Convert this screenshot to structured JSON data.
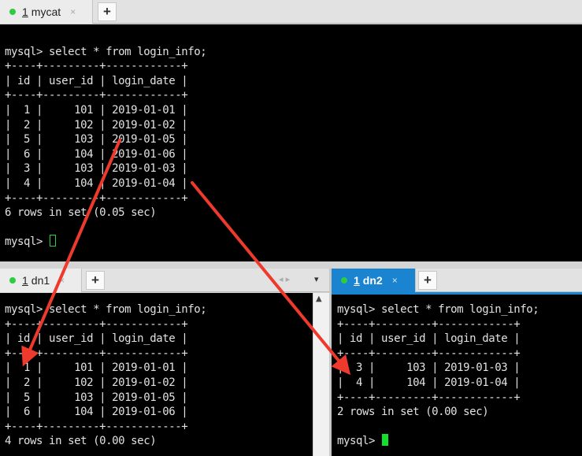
{
  "top_pane": {
    "tab": {
      "number": "1",
      "name": "mycat",
      "close": "×"
    },
    "add_tab": "+",
    "lines": [
      "",
      "mysql> select * from login_info;",
      "+----+---------+------------+",
      "| id | user_id | login_date |",
      "+----+---------+------------+",
      "|  1 |     101 | 2019-01-01 |",
      "|  2 |     102 | 2019-01-02 |",
      "|  5 |     103 | 2019-01-05 |",
      "|  6 |     104 | 2019-01-06 |",
      "|  3 |     103 | 2019-01-03 |",
      "|  4 |     104 | 2019-01-04 |",
      "+----+---------+------------+",
      "6 rows in set (0.05 sec)",
      "",
      "mysql> "
    ]
  },
  "left_pane": {
    "tab": {
      "number": "1",
      "name": "dn1",
      "close": "×"
    },
    "add_tab": "+",
    "nav_arrows": "◂ ▸",
    "dropdown": "▾",
    "scroll_up": "▲",
    "lines": [
      "mysql> select * from login_info;",
      "+----+---------+------------+",
      "| id | user_id | login_date |",
      "+----+---------+------------+",
      "|  1 |     101 | 2019-01-01 |",
      "|  2 |     102 | 2019-01-02 |",
      "|  5 |     103 | 2019-01-05 |",
      "|  6 |     104 | 2019-01-06 |",
      "+----+---------+------------+",
      "4 rows in set (0.00 sec)"
    ]
  },
  "right_pane": {
    "tab": {
      "number": "1",
      "name": "dn2",
      "close": "×"
    },
    "add_tab": "+",
    "lines": [
      "mysql> select * from login_info;",
      "+----+---------+------------+",
      "| id | user_id | login_date |",
      "+----+---------+------------+",
      "|  3 |     103 | 2019-01-03 |",
      "|  4 |     104 | 2019-01-04 |",
      "+----+---------+------------+",
      "2 rows in set (0.00 sec)",
      "",
      "mysql> "
    ]
  },
  "colors": {
    "terminal_bg": "#000000",
    "terminal_text": "#e2e2e2",
    "cursor": "#12e02a",
    "status_dot": "#2ecc40",
    "active_tab": "#1a84d0",
    "annotation_arrow": "#ee3a2c"
  },
  "icons": {
    "status": "green-dot-icon",
    "add": "plus-icon",
    "close": "close-x-icon",
    "annotation": "red-arrow-icon"
  }
}
